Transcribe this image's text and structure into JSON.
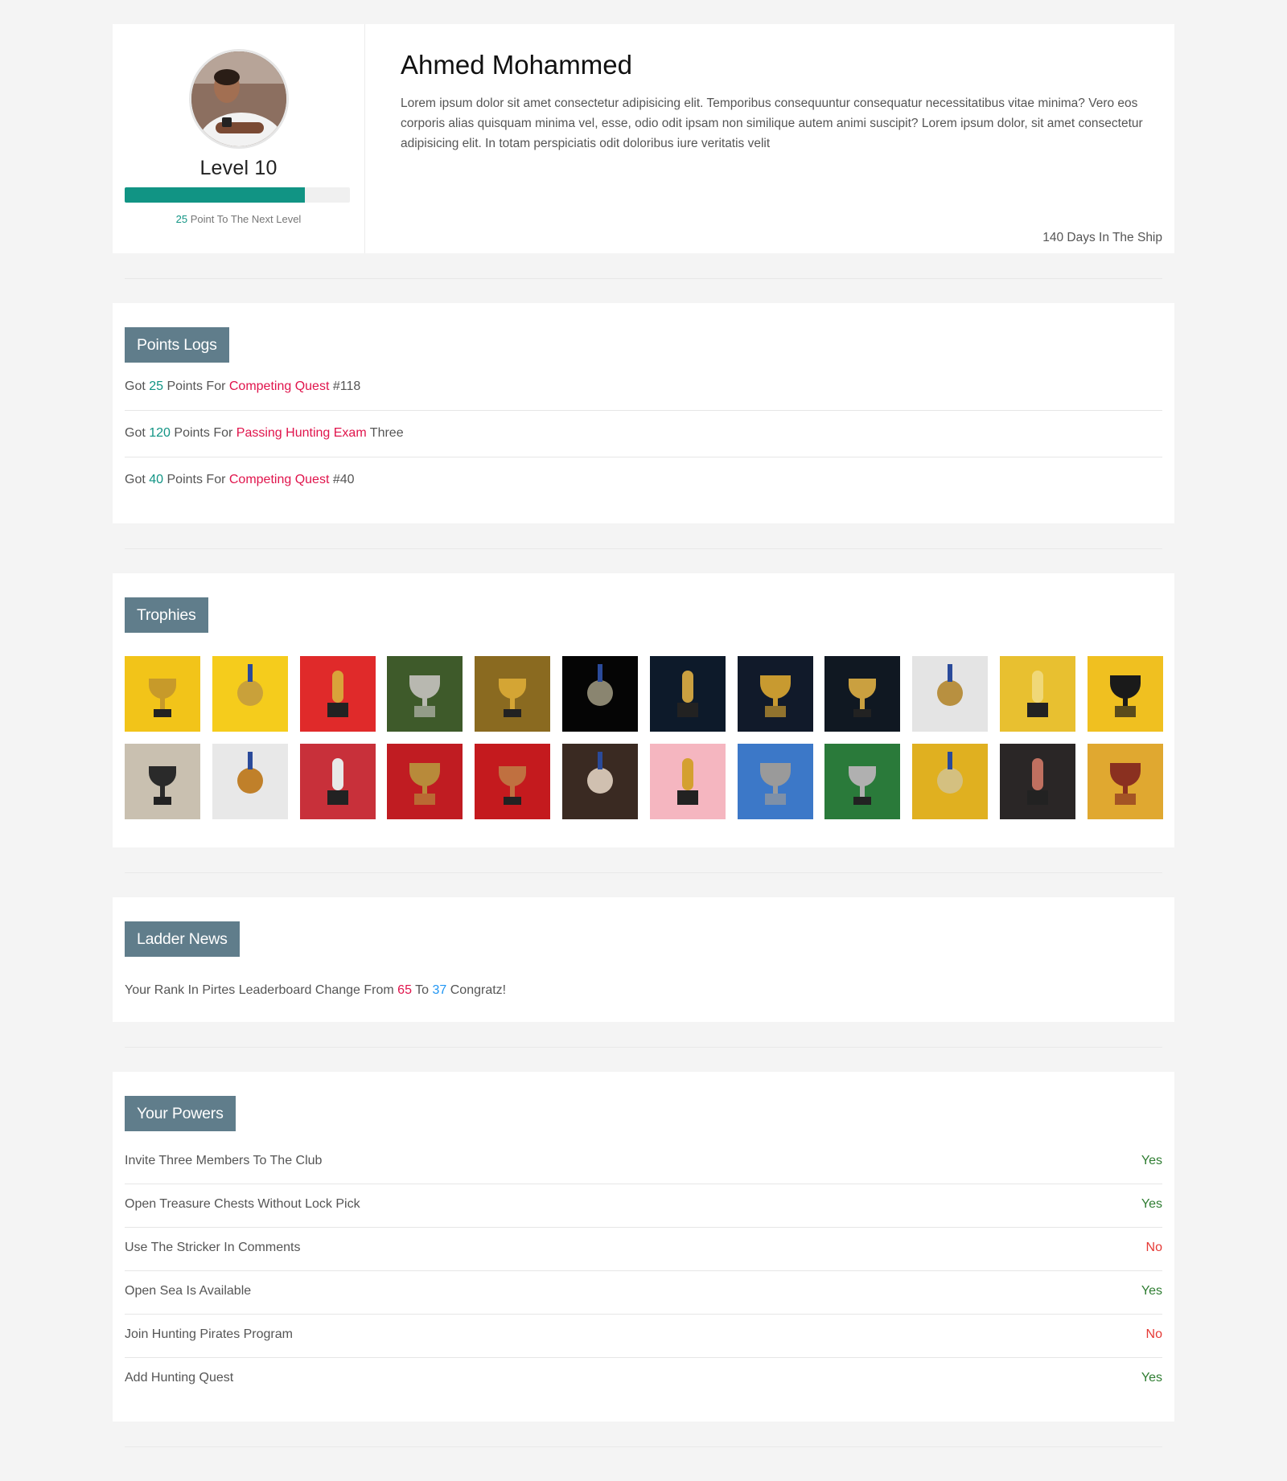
{
  "profile": {
    "name": "Ahmed Mohammed",
    "level": "Level 10",
    "progress_fraction": 0.8,
    "next_points": "25",
    "next_label": "Point To The Next Level",
    "bio": "Lorem ipsum dolor sit amet consectetur adipisicing elit. Temporibus consequuntur consequatur necessitatibus vitae minima? Vero eos corporis alias quisquam minima vel, esse, odio odit ipsam non similique autem animi suscipit? Lorem ipsum dolor, sit amet consectetur adipisicing elit. In totam perspiciatis odit doloribus iure veritatis velit",
    "days": "140 Days In The Ship"
  },
  "points_logs": {
    "title": "Points Logs",
    "items": [
      {
        "pre": "Got",
        "points": "25",
        "mid": "Points For",
        "link": "Competing Quest",
        "post": "#118"
      },
      {
        "pre": "Got",
        "points": "120",
        "mid": "Points For",
        "link": "Passing Hunting Exam",
        "post": "Three"
      },
      {
        "pre": "Got",
        "points": "40",
        "mid": "Points For",
        "link": "Competing Quest",
        "post": "#40"
      }
    ]
  },
  "trophies": {
    "title": "Trophies",
    "images": [
      {
        "bg": "#f2c419",
        "fg": "#c79a2a",
        "name": "trophy-hands-yellow"
      },
      {
        "bg": "#f5cc1c",
        "fg": "#c9a13a",
        "name": "trophy-hand-yellow"
      },
      {
        "bg": "#e02a2a",
        "fg": "#d9a33a",
        "name": "trophy-red"
      },
      {
        "bg": "#3e5a2a",
        "fg": "#b8b8b0",
        "name": "trophy-silver-leaves"
      },
      {
        "bg": "#8a6a20",
        "fg": "#d4a534",
        "name": "trophy-smoke"
      },
      {
        "bg": "#050505",
        "fg": "#8a8570",
        "name": "statuette-dark"
      },
      {
        "bg": "#0d1a2a",
        "fg": "#caa040",
        "name": "medal-dice"
      },
      {
        "bg": "#111a2a",
        "fg": "#c89a30",
        "name": "medal-confetti"
      },
      {
        "bg": "#101822",
        "fg": "#caa040",
        "name": "medal-blue-ribbon"
      },
      {
        "bg": "#e4e4e4",
        "fg": "#b89040",
        "name": "trophy-gold-white"
      },
      {
        "bg": "#e8c030",
        "fg": "#f0d878",
        "name": "trophy-yellow-dots"
      },
      {
        "bg": "#f0c020",
        "fg": "#1a1a1a",
        "name": "trophy-yellow-blue"
      },
      {
        "bg": "#c9c0b0",
        "fg": "#2a2a2a",
        "name": "trophy-hands-black"
      },
      {
        "bg": "#e8e8e8",
        "fg": "#c0802a",
        "name": "statuette-white"
      },
      {
        "bg": "#c8303a",
        "fg": "#e8e8e8",
        "name": "trophy-soccer-red"
      },
      {
        "bg": "#c01c22",
        "fg": "#b88a3a",
        "name": "trophy-red-dark"
      },
      {
        "bg": "#c41a1e",
        "fg": "#c07040",
        "name": "medal-basketball"
      },
      {
        "bg": "#3a2a22",
        "fg": "#d0c0b0",
        "name": "trophy-hand-dark"
      },
      {
        "bg": "#f5b6c0",
        "fg": "#d4a030",
        "name": "trophy-pink"
      },
      {
        "bg": "#3c78c8",
        "fg": "#9a9a9a",
        "name": "trophy-blue-sky"
      },
      {
        "bg": "#2a7a3a",
        "fg": "#b0b0b0",
        "name": "trophy-court"
      },
      {
        "bg": "#e0b020",
        "fg": "#d4c080",
        "name": "trophy-yellow-blur"
      },
      {
        "bg": "#2a2626",
        "fg": "#c07060",
        "name": "trophies-soccer"
      },
      {
        "bg": "#e0a830",
        "fg": "#8a3020",
        "name": "trophy-hand-orange"
      }
    ]
  },
  "ladder": {
    "title": "Ladder News",
    "pre": "Your Rank In Pirtes Leaderboard Change From",
    "from": "65",
    "mid": "To",
    "to": "37",
    "post": "Congratz!"
  },
  "powers": {
    "title": "Your Powers",
    "items": [
      {
        "label": "Invite Three Members To The Club",
        "value": "Yes"
      },
      {
        "label": "Open Treasure Chests Without Lock Pick",
        "value": "Yes"
      },
      {
        "label": "Use The Stricker In Comments",
        "value": "No"
      },
      {
        "label": "Open Sea Is Available",
        "value": "Yes"
      },
      {
        "label": "Join Hunting Pirates Program",
        "value": "No"
      },
      {
        "label": "Add Hunting Quest",
        "value": "Yes"
      }
    ]
  },
  "colors": {
    "accent": "#119484",
    "badge": "#607d8b",
    "link": "#e0144c",
    "yes": "#2f7d32",
    "no": "#e53935"
  }
}
